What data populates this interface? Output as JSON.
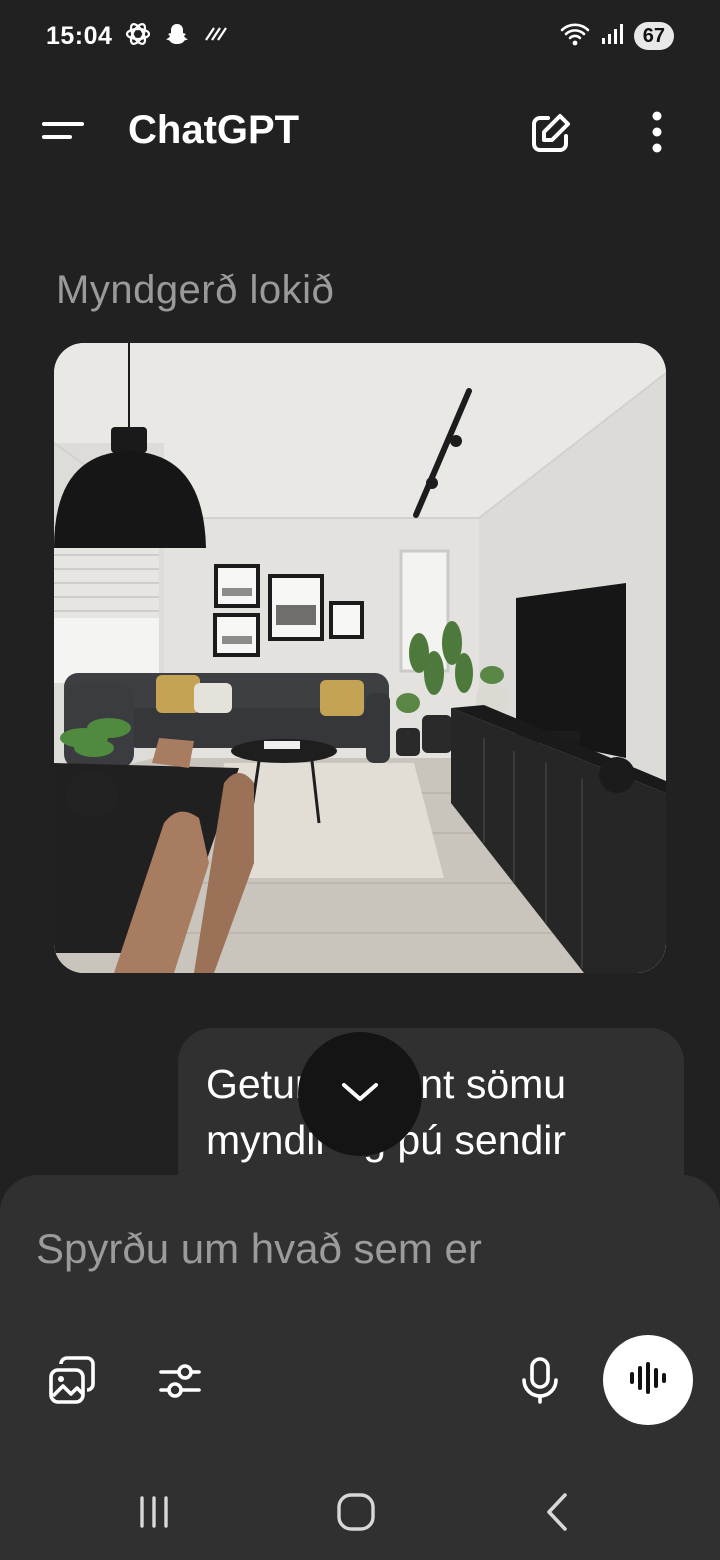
{
  "status_bar": {
    "time": "15:04",
    "battery": "67",
    "icons": [
      "openai-icon",
      "snapchat-icon",
      "data-sync-icon",
      "wifi-icon",
      "signal-icon"
    ]
  },
  "header": {
    "title": "ChatGPT",
    "icons": [
      "menu-icon",
      "new-chat-icon",
      "more-vertical-icon"
    ]
  },
  "chat": {
    "status_text": "Myndgerð lokið",
    "user_message": "Getur þú sent sömu myndir og þú sendir"
  },
  "composer": {
    "placeholder": "Spyrðu um hvað sem er",
    "value": "",
    "icons": [
      "image-icon",
      "tools-icon",
      "microphone-icon",
      "voice-mode-icon"
    ]
  },
  "nav_bar": {
    "icons": [
      "recents-icon",
      "home-icon",
      "back-icon"
    ]
  },
  "colors": {
    "background": "#212121",
    "surface": "#303030",
    "muted_text": "#9a9a9a",
    "accent_white": "#ffffff"
  }
}
